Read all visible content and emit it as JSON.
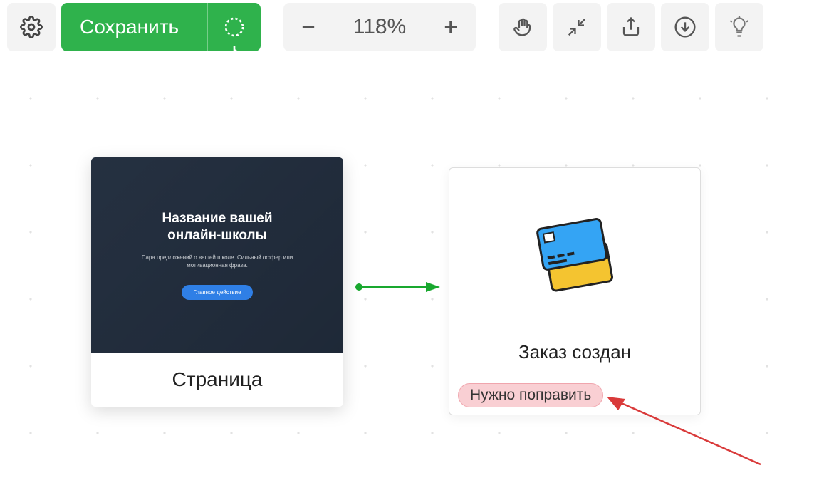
{
  "toolbar": {
    "save_label": "Сохранить",
    "zoom_level": "118%"
  },
  "canvas": {
    "page_card": {
      "heading_line1": "Название вашей",
      "heading_line2": "онлайн-школы",
      "subtext": "Пара предложений о вашей школе. Сильный оффер или мотивационная фраза.",
      "cta_label": "Главное действие",
      "card_label": "Страница"
    },
    "order_card": {
      "title": "Заказ создан",
      "badge": "Нужно поправить"
    }
  }
}
